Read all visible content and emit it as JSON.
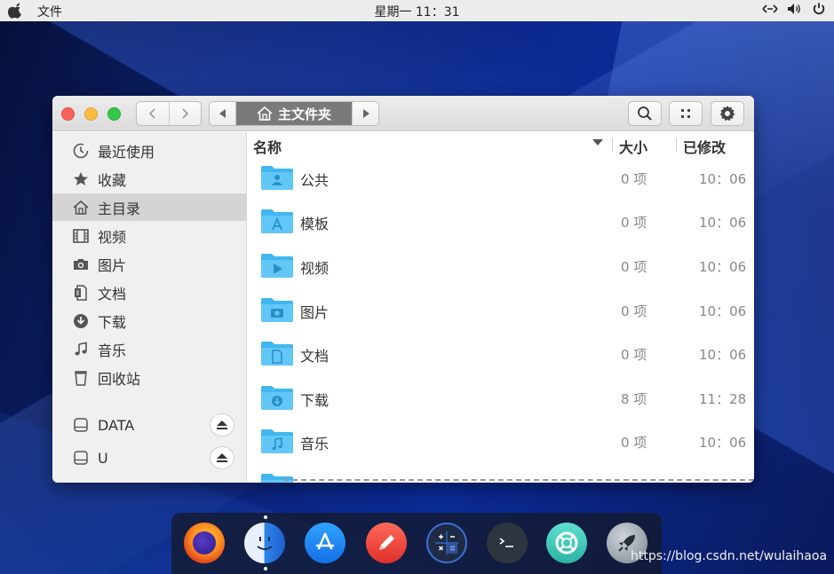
{
  "topbar": {
    "app_name": "文件",
    "clock": "星期一 11：31"
  },
  "window": {
    "path": {
      "current_folder": "主文件夹"
    }
  },
  "sidebar": {
    "items": [
      {
        "label": "最近使用",
        "icon": "clock-icon"
      },
      {
        "label": "收藏",
        "icon": "star-icon"
      },
      {
        "label": "主目录",
        "icon": "home-icon"
      },
      {
        "label": "视频",
        "icon": "film-icon"
      },
      {
        "label": "图片",
        "icon": "camera-icon"
      },
      {
        "label": "文档",
        "icon": "document-icon"
      },
      {
        "label": "下载",
        "icon": "download-icon"
      },
      {
        "label": "音乐",
        "icon": "music-icon"
      },
      {
        "label": "回收站",
        "icon": "trash-icon"
      }
    ],
    "devices": [
      {
        "label": "DATA",
        "icon": "drive-icon"
      },
      {
        "label": "U",
        "icon": "drive-icon"
      }
    ]
  },
  "columns": {
    "name": "名称",
    "size": "大小",
    "modified": "已修改"
  },
  "files": [
    {
      "name": "公共",
      "size": "0 项",
      "modified": "10：06",
      "icon": "public-folder-icon"
    },
    {
      "name": "模板",
      "size": "0 项",
      "modified": "10：06",
      "icon": "templates-folder-icon"
    },
    {
      "name": "视频",
      "size": "0 项",
      "modified": "10：06",
      "icon": "videos-folder-icon"
    },
    {
      "name": "图片",
      "size": "0 项",
      "modified": "10：06",
      "icon": "pictures-folder-icon"
    },
    {
      "name": "文档",
      "size": "0 项",
      "modified": "10：06",
      "icon": "documents-folder-icon"
    },
    {
      "name": "下载",
      "size": "8 项",
      "modified": "11：28",
      "icon": "downloads-folder-icon"
    },
    {
      "name": "音乐",
      "size": "0 项",
      "modified": "10：06",
      "icon": "music-folder-icon"
    }
  ],
  "dock": {
    "apps": [
      "firefox-icon",
      "finder-icon",
      "app-store-icon",
      "text-editor-icon",
      "calculator-icon",
      "terminal-icon",
      "help-icon",
      "launchpad-icon"
    ]
  },
  "watermark": "https://blog.csdn.net/wulaihaoa",
  "colors": {
    "folder_blue": "#3fb6f0",
    "folder_blue_light": "#78d0fa",
    "sidebar_active": "#d4d4d4",
    "path_active": "#7a7a7a"
  }
}
